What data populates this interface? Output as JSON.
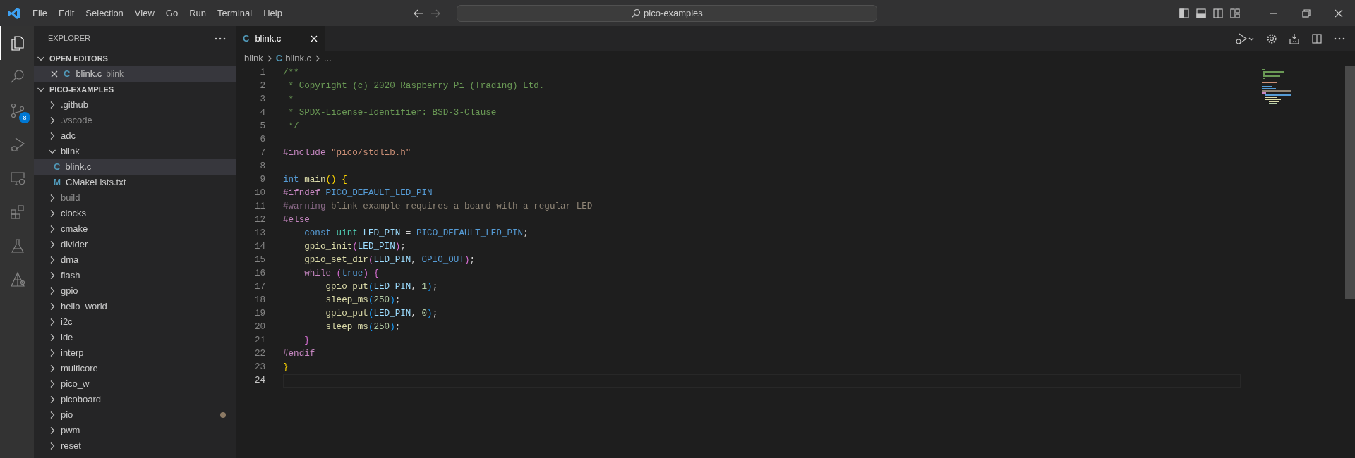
{
  "title_bar": {
    "menu": [
      "File",
      "Edit",
      "Selection",
      "View",
      "Go",
      "Run",
      "Terminal",
      "Help"
    ],
    "command_center": "pico-examples"
  },
  "activity_bar": [
    {
      "kind": "explorer",
      "selected": true
    },
    {
      "kind": "search",
      "selected": false
    },
    {
      "kind": "source-control",
      "selected": false,
      "badge": "8"
    },
    {
      "kind": "run-debug",
      "selected": false
    },
    {
      "kind": "remote",
      "selected": false
    },
    {
      "kind": "extensions",
      "selected": false
    },
    {
      "kind": "testing",
      "selected": false
    },
    {
      "kind": "pico",
      "selected": false
    }
  ],
  "sidebar": {
    "title": "EXPLORER",
    "open_editors": {
      "title": "OPEN EDITORS",
      "expanded": true,
      "items": [
        {
          "name": "blink.c",
          "description": "blink",
          "icon": "C",
          "selected": true
        }
      ]
    },
    "folder": {
      "title": "PICO-EXAMPLES",
      "expanded": true,
      "items": [
        {
          "name": ".github",
          "kind": "folder",
          "expanded": false,
          "dimmed": false,
          "selected": false,
          "modified": false
        },
        {
          "name": ".vscode",
          "kind": "folder",
          "expanded": false,
          "dimmed": true,
          "selected": false,
          "modified": false
        },
        {
          "name": "adc",
          "kind": "folder",
          "expanded": false,
          "dimmed": false,
          "selected": false,
          "modified": false
        },
        {
          "name": "blink",
          "kind": "folder",
          "expanded": true,
          "dimmed": false,
          "selected": false,
          "modified": false,
          "children": [
            {
              "name": "blink.c",
              "kind": "file",
              "icon": "C",
              "dimmed": false,
              "selected": true,
              "modified": false
            },
            {
              "name": "CMakeLists.txt",
              "kind": "file",
              "icon": "M",
              "dimmed": false,
              "selected": false,
              "modified": false
            }
          ]
        },
        {
          "name": "build",
          "kind": "folder",
          "expanded": false,
          "dimmed": true,
          "selected": false,
          "modified": false
        },
        {
          "name": "clocks",
          "kind": "folder",
          "expanded": false,
          "dimmed": false,
          "selected": false,
          "modified": false
        },
        {
          "name": "cmake",
          "kind": "folder",
          "expanded": false,
          "dimmed": false,
          "selected": false,
          "modified": false
        },
        {
          "name": "divider",
          "kind": "folder",
          "expanded": false,
          "dimmed": false,
          "selected": false,
          "modified": false
        },
        {
          "name": "dma",
          "kind": "folder",
          "expanded": false,
          "dimmed": false,
          "selected": false,
          "modified": false
        },
        {
          "name": "flash",
          "kind": "folder",
          "expanded": false,
          "dimmed": false,
          "selected": false,
          "modified": false
        },
        {
          "name": "gpio",
          "kind": "folder",
          "expanded": false,
          "dimmed": false,
          "selected": false,
          "modified": false
        },
        {
          "name": "hello_world",
          "kind": "folder",
          "expanded": false,
          "dimmed": false,
          "selected": false,
          "modified": false
        },
        {
          "name": "i2c",
          "kind": "folder",
          "expanded": false,
          "dimmed": false,
          "selected": false,
          "modified": false
        },
        {
          "name": "ide",
          "kind": "folder",
          "expanded": false,
          "dimmed": false,
          "selected": false,
          "modified": false
        },
        {
          "name": "interp",
          "kind": "folder",
          "expanded": false,
          "dimmed": false,
          "selected": false,
          "modified": false
        },
        {
          "name": "multicore",
          "kind": "folder",
          "expanded": false,
          "dimmed": false,
          "selected": false,
          "modified": false
        },
        {
          "name": "pico_w",
          "kind": "folder",
          "expanded": false,
          "dimmed": false,
          "selected": false,
          "modified": false
        },
        {
          "name": "picoboard",
          "kind": "folder",
          "expanded": false,
          "dimmed": false,
          "selected": false,
          "modified": false
        },
        {
          "name": "pio",
          "kind": "folder",
          "expanded": false,
          "dimmed": false,
          "selected": false,
          "modified": true
        },
        {
          "name": "pwm",
          "kind": "folder",
          "expanded": false,
          "dimmed": false,
          "selected": false,
          "modified": false
        },
        {
          "name": "reset",
          "kind": "folder",
          "expanded": false,
          "dimmed": false,
          "selected": false,
          "modified": false
        }
      ]
    }
  },
  "editor": {
    "tabs": [
      {
        "label": "blink.c",
        "icon": "C",
        "selected": true
      }
    ],
    "breadcrumb": [
      {
        "label": "blink"
      },
      {
        "label": "blink.c",
        "icon": "C"
      },
      {
        "label": "..."
      }
    ],
    "lines": [
      {
        "number": "1",
        "current": false,
        "tokens": [
          {
            "text": "/**",
            "kind": "comment"
          }
        ]
      },
      {
        "number": "2",
        "current": false,
        "tokens": [
          {
            "text": " * Copyright (c) 2020 Raspberry Pi (Trading) Ltd.",
            "kind": "comment"
          }
        ]
      },
      {
        "number": "3",
        "current": false,
        "tokens": [
          {
            "text": " *",
            "kind": "comment"
          }
        ]
      },
      {
        "number": "4",
        "current": false,
        "tokens": [
          {
            "text": " * SPDX-License-Identifier: BSD-3-Clause",
            "kind": "comment"
          }
        ]
      },
      {
        "number": "5",
        "current": false,
        "tokens": [
          {
            "text": " */",
            "kind": "comment"
          }
        ]
      },
      {
        "number": "6",
        "current": false
      },
      {
        "number": "7",
        "current": false,
        "tokens": [
          {
            "text": "#include",
            "kind": "directive"
          },
          {
            "text": " \"pico/stdlib.h\"",
            "kind": "string"
          }
        ]
      },
      {
        "number": "8",
        "current": false
      },
      {
        "number": "9",
        "current": false,
        "tokens": [
          {
            "text": "int",
            "kind": "keyword"
          },
          {
            "text": " main",
            "kind": "function"
          },
          {
            "text": "()",
            "kind": "bracket1"
          },
          {
            "text": " {",
            "kind": "bracket1"
          }
        ]
      },
      {
        "number": "10",
        "current": false,
        "tokens": [
          {
            "text": "#ifndef",
            "kind": "directive"
          },
          {
            "text": " PICO_DEFAULT_LED_PIN",
            "kind": "macro"
          }
        ]
      },
      {
        "number": "11",
        "current": false,
        "tokens": [
          {
            "text": "#warning",
            "kind": "inactive-directive"
          },
          {
            "text": " blink example requires a board with a regular LED",
            "kind": "inactive"
          }
        ]
      },
      {
        "number": "12",
        "current": false,
        "tokens": [
          {
            "text": "#else",
            "kind": "directive"
          }
        ]
      },
      {
        "number": "13",
        "current": false,
        "tokens": [
          {
            "text": "    const",
            "kind": "keyword"
          },
          {
            "text": " uint",
            "kind": "type"
          },
          {
            "text": " LED_PIN",
            "kind": "variable"
          },
          {
            "text": " = ",
            "kind": "plain"
          },
          {
            "text": "PICO_DEFAULT_LED_PIN",
            "kind": "macro"
          },
          {
            "text": ";",
            "kind": "plain"
          }
        ]
      },
      {
        "number": "14",
        "current": false,
        "tokens": [
          {
            "text": "    gpio_init",
            "kind": "function"
          },
          {
            "text": "(",
            "kind": "bracket2"
          },
          {
            "text": "LED_PIN",
            "kind": "variable"
          },
          {
            "text": ")",
            "kind": "bracket2"
          },
          {
            "text": ";",
            "kind": "plain"
          }
        ]
      },
      {
        "number": "15",
        "current": false,
        "tokens": [
          {
            "text": "    gpio_set_dir",
            "kind": "function"
          },
          {
            "text": "(",
            "kind": "bracket2"
          },
          {
            "text": "LED_PIN",
            "kind": "variable"
          },
          {
            "text": ", ",
            "kind": "plain"
          },
          {
            "text": "GPIO_OUT",
            "kind": "macro"
          },
          {
            "text": ")",
            "kind": "bracket2"
          },
          {
            "text": ";",
            "kind": "plain"
          }
        ]
      },
      {
        "number": "16",
        "current": false,
        "tokens": [
          {
            "text": "    while",
            "kind": "control"
          },
          {
            "text": " (",
            "kind": "bracket2"
          },
          {
            "text": "true",
            "kind": "keyword"
          },
          {
            "text": ")",
            "kind": "bracket2"
          },
          {
            "text": " {",
            "kind": "bracket2"
          }
        ]
      },
      {
        "number": "17",
        "current": false,
        "tokens": [
          {
            "text": "        gpio_put",
            "kind": "function"
          },
          {
            "text": "(",
            "kind": "bracket3"
          },
          {
            "text": "LED_PIN",
            "kind": "variable"
          },
          {
            "text": ", ",
            "kind": "plain"
          },
          {
            "text": "1",
            "kind": "number"
          },
          {
            "text": ")",
            "kind": "bracket3"
          },
          {
            "text": ";",
            "kind": "plain"
          }
        ]
      },
      {
        "number": "18",
        "current": false,
        "tokens": [
          {
            "text": "        sleep_ms",
            "kind": "function"
          },
          {
            "text": "(",
            "kind": "bracket3"
          },
          {
            "text": "250",
            "kind": "number"
          },
          {
            "text": ")",
            "kind": "bracket3"
          },
          {
            "text": ";",
            "kind": "plain"
          }
        ]
      },
      {
        "number": "19",
        "current": false,
        "tokens": [
          {
            "text": "        gpio_put",
            "kind": "function"
          },
          {
            "text": "(",
            "kind": "bracket3"
          },
          {
            "text": "LED_PIN",
            "kind": "variable"
          },
          {
            "text": ", ",
            "kind": "plain"
          },
          {
            "text": "0",
            "kind": "number"
          },
          {
            "text": ")",
            "kind": "bracket3"
          },
          {
            "text": ";",
            "kind": "plain"
          }
        ]
      },
      {
        "number": "20",
        "current": false,
        "tokens": [
          {
            "text": "        sleep_ms",
            "kind": "function"
          },
          {
            "text": "(",
            "kind": "bracket3"
          },
          {
            "text": "250",
            "kind": "number"
          },
          {
            "text": ")",
            "kind": "bracket3"
          },
          {
            "text": ";",
            "kind": "plain"
          }
        ]
      },
      {
        "number": "21",
        "current": false,
        "tokens": [
          {
            "text": "    }",
            "kind": "bracket2"
          }
        ]
      },
      {
        "number": "22",
        "current": false,
        "tokens": [
          {
            "text": "#endif",
            "kind": "directive"
          }
        ]
      },
      {
        "number": "23",
        "current": false,
        "tokens": [
          {
            "text": "}",
            "kind": "bracket1"
          }
        ]
      },
      {
        "number": "24",
        "current": true
      }
    ]
  }
}
